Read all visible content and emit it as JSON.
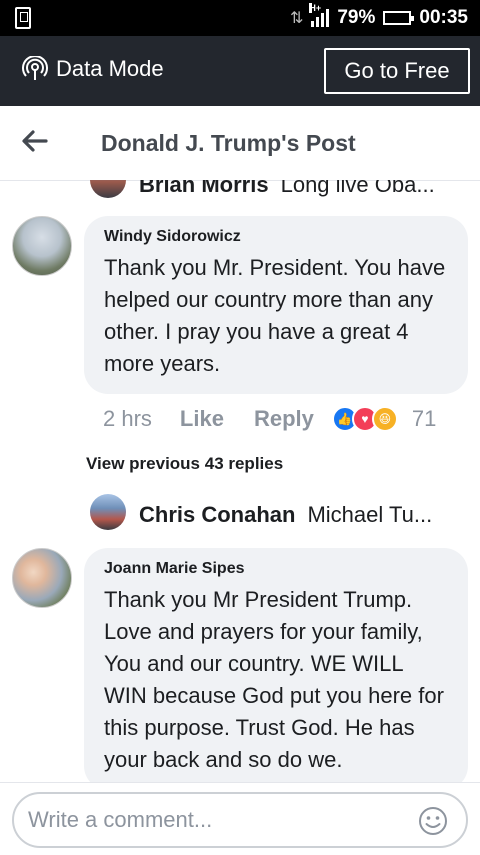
{
  "status_bar": {
    "battery_percent": "79%",
    "time": "00:35",
    "battery_level": 0.79,
    "network_label": "H+"
  },
  "data_bar": {
    "mode_label": "Data Mode",
    "go_free_label": "Go to Free"
  },
  "header": {
    "title": "Donald J. Trump's Post"
  },
  "replies_top": {
    "name": "Brian Morris",
    "text": "Long live Oba..."
  },
  "comment1": {
    "author": "Windy Sidorowicz",
    "body": "Thank you Mr. President.  You have helped our country more than any other. I pray you have a great 4 more years.",
    "time": "2 hrs",
    "like_label": "Like",
    "reply_label": "Reply",
    "reaction_count": "71"
  },
  "view_previous": "View previous 43 replies",
  "reply2": {
    "name": "Chris Conahan",
    "text": "Michael Tu..."
  },
  "comment2": {
    "author": "Joann Marie Sipes",
    "body": "Thank you Mr President Trump. Love and prayers for your family, You and our country. WE WILL WIN because God put you here for this purpose. Trust God. He has your back and so do we."
  },
  "footer": {
    "placeholder": "Write a comment..."
  },
  "colors": {
    "like_blue": "#1877f2",
    "love_red": "#f33e58",
    "haha_yellow": "#f7b125",
    "bubble_bg": "#f0f2f5",
    "data_bar_bg": "#23272e"
  }
}
